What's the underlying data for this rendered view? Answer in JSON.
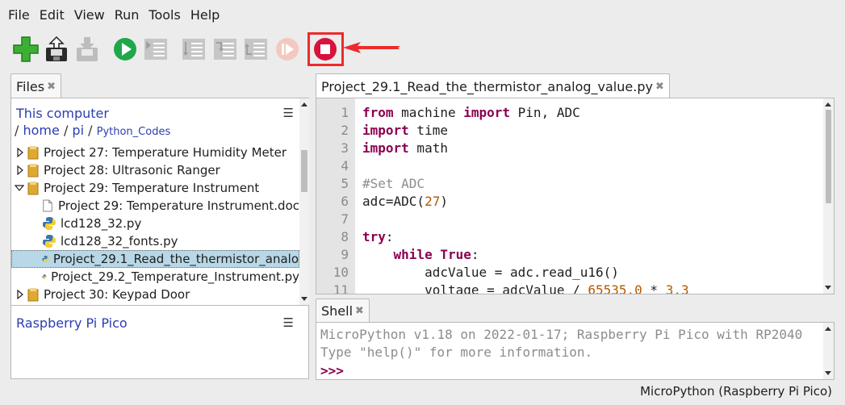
{
  "menu": [
    "File",
    "Edit",
    "View",
    "Run",
    "Tools",
    "Help"
  ],
  "toolbar": {
    "buttons": [
      {
        "name": "new-file-button",
        "icon": "plus-icon"
      },
      {
        "name": "open-file-button",
        "icon": "open-icon"
      },
      {
        "name": "save-file-button",
        "icon": "save-icon"
      },
      {
        "name": "run-button",
        "icon": "play-icon"
      },
      {
        "name": "debug-button",
        "icon": "debug-icon"
      },
      {
        "name": "step-over-button",
        "icon": "step-over-icon"
      },
      {
        "name": "step-into-button",
        "icon": "step-into-icon"
      },
      {
        "name": "step-out-button",
        "icon": "step-out-icon"
      },
      {
        "name": "resume-button",
        "icon": "resume-icon"
      },
      {
        "name": "stop-button",
        "icon": "stop-icon"
      }
    ]
  },
  "files": {
    "tab_label": "Files",
    "this_computer": "This computer",
    "crumb": {
      "sep": "/",
      "home": "home",
      "pi": "pi",
      "codes": "Python_Codes"
    },
    "rows": [
      {
        "label": "Project 27: Temperature Humidity Meter",
        "kind": "folder",
        "expanded": false
      },
      {
        "label": "Project 28: Ultrasonic Ranger",
        "kind": "folder",
        "expanded": false
      },
      {
        "label": "Project 29: Temperature Instrument",
        "kind": "folder",
        "expanded": true
      },
      {
        "label": "Project 29: Temperature Instrument.doc",
        "kind": "doc"
      },
      {
        "label": "lcd128_32.py",
        "kind": "py"
      },
      {
        "label": "lcd128_32_fonts.py",
        "kind": "py"
      },
      {
        "label": "Project_29.1_Read_the_thermistor_analo",
        "kind": "py",
        "selected": true
      },
      {
        "label": "Project_29.2_Temperature_Instrument.py",
        "kind": "py"
      },
      {
        "label": "Project 30: Keypad Door",
        "kind": "folder",
        "expanded": false
      }
    ],
    "device_title": "Raspberry Pi Pico"
  },
  "editor": {
    "tab_label": "Project_29.1_Read_the_thermistor_analog_value.py",
    "lines": [
      "1",
      "2",
      "3",
      "4",
      "5",
      "6",
      "7",
      "8",
      "9",
      "10",
      "11"
    ],
    "code": {
      "l1_kw": "from",
      "l1_mid": " machine ",
      "l1_kw2": "import",
      "l1_end": " Pin, ADC",
      "l2_kw": "import",
      "l2_end": " time",
      "l3_kw": "import",
      "l3_end": " math",
      "l5": "#Set ADC",
      "l6_a": "adc=ADC(",
      "l6_n": "27",
      "l6_b": ")",
      "l8_kw": "try",
      ":": ":",
      "l9_pre": "    ",
      "l9_kw": "while",
      "l9_kw2": "True",
      "l9_end": ":",
      "l10": "        adcValue = adc.read_u16()",
      "l11_a": "        voltage = adcValue / ",
      "l11_n": "65535.0",
      "l11_b": " * ",
      "l11_n2": "3.3"
    }
  },
  "shell": {
    "tab_label": "Shell",
    "line1": "MicroPython v1.18 on 2022-01-17; Raspberry Pi Pico with RP2040",
    "line2": "Type \"help()\" for more information.",
    "prompt": ">>>"
  },
  "status": "MicroPython (Raspberry Pi Pico)",
  "colors": {
    "highlight": "#ec2b2b",
    "keyword": "#8b0050",
    "selection": "#b8d7e7"
  }
}
